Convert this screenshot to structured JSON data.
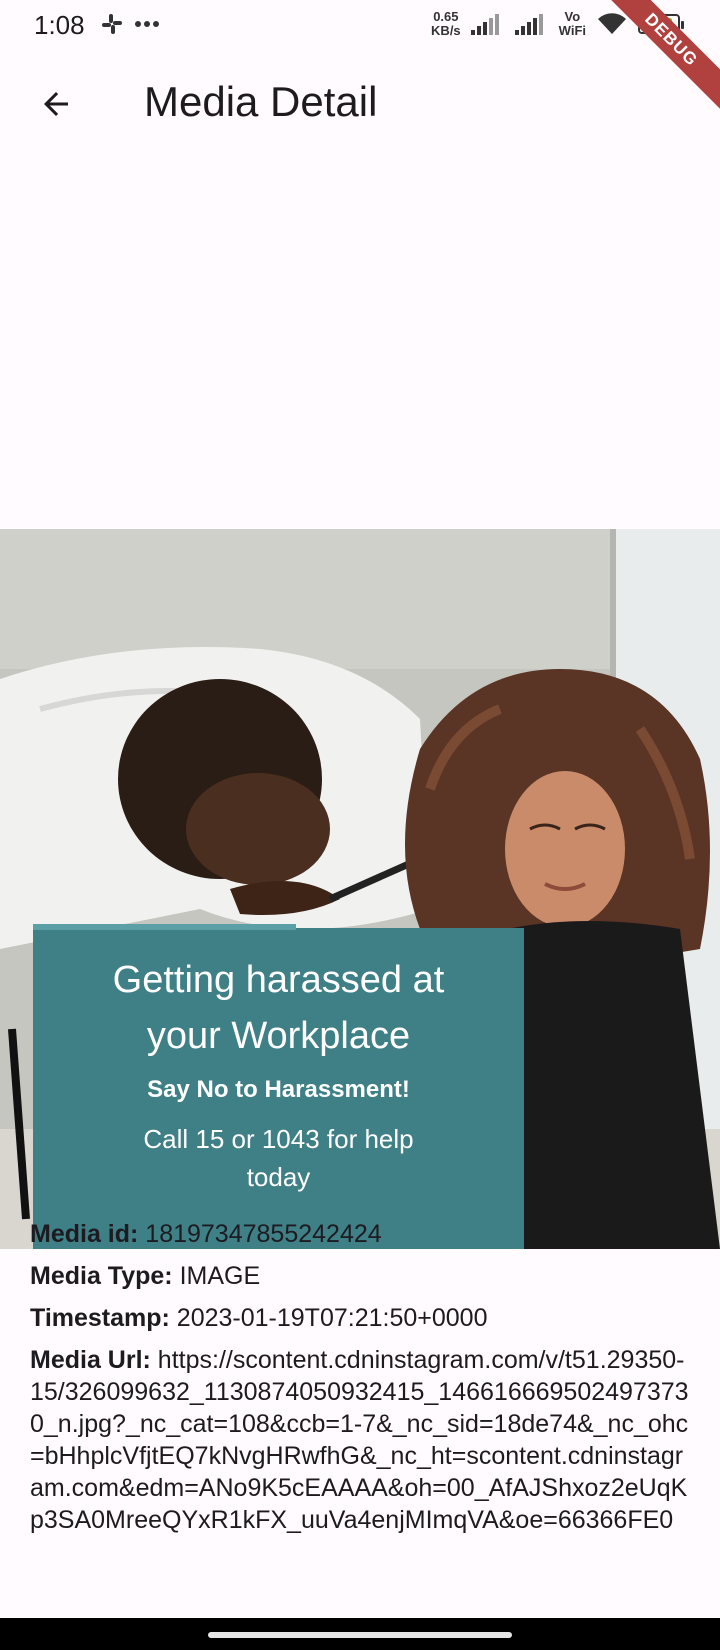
{
  "status_bar": {
    "time": "1:08",
    "net_speed_value": "0.65",
    "net_speed_unit": "KB/s",
    "vowifi_top": "Vo",
    "vowifi_bottom": "WiFi",
    "battery": "97"
  },
  "debug_banner": "DEBUG",
  "app_bar": {
    "title": "Media Detail"
  },
  "media": {
    "poster_heading_line1": "Getting harassed at",
    "poster_heading_line2": "your Workplace",
    "poster_subheading": "Say No to Harassment!",
    "poster_line1": "Call 15 or 1043 for help",
    "poster_line2": "today",
    "accent_color": "#3f7f86"
  },
  "details": {
    "id_label": "Media id:",
    "id_value": " 18197347855242424",
    "type_label": "Media Type:",
    "type_value": " IMAGE",
    "timestamp_label": "Timestamp:",
    "timestamp_value": " 2023-01-19T07:21:50+0000",
    "url_label": "Media Url:",
    "url_value": " https://scontent.cdninstagram.com/v/t51.29350-15/326099632_1130874050932415_1466166695024973730_n.jpg?_nc_cat=108&ccb=1-7&_nc_sid=18de74&_nc_ohc=bHhplcVfjtEQ7kNvgHRwfhG&_nc_ht=scontent.cdninstagram.com&edm=ANo9K5cEAAAA&oh=00_AfAJShxoz2eUqKp3SA0MreeQYxR1kFX_uuVa4enjMImqVA&oe=66366FE0"
  }
}
